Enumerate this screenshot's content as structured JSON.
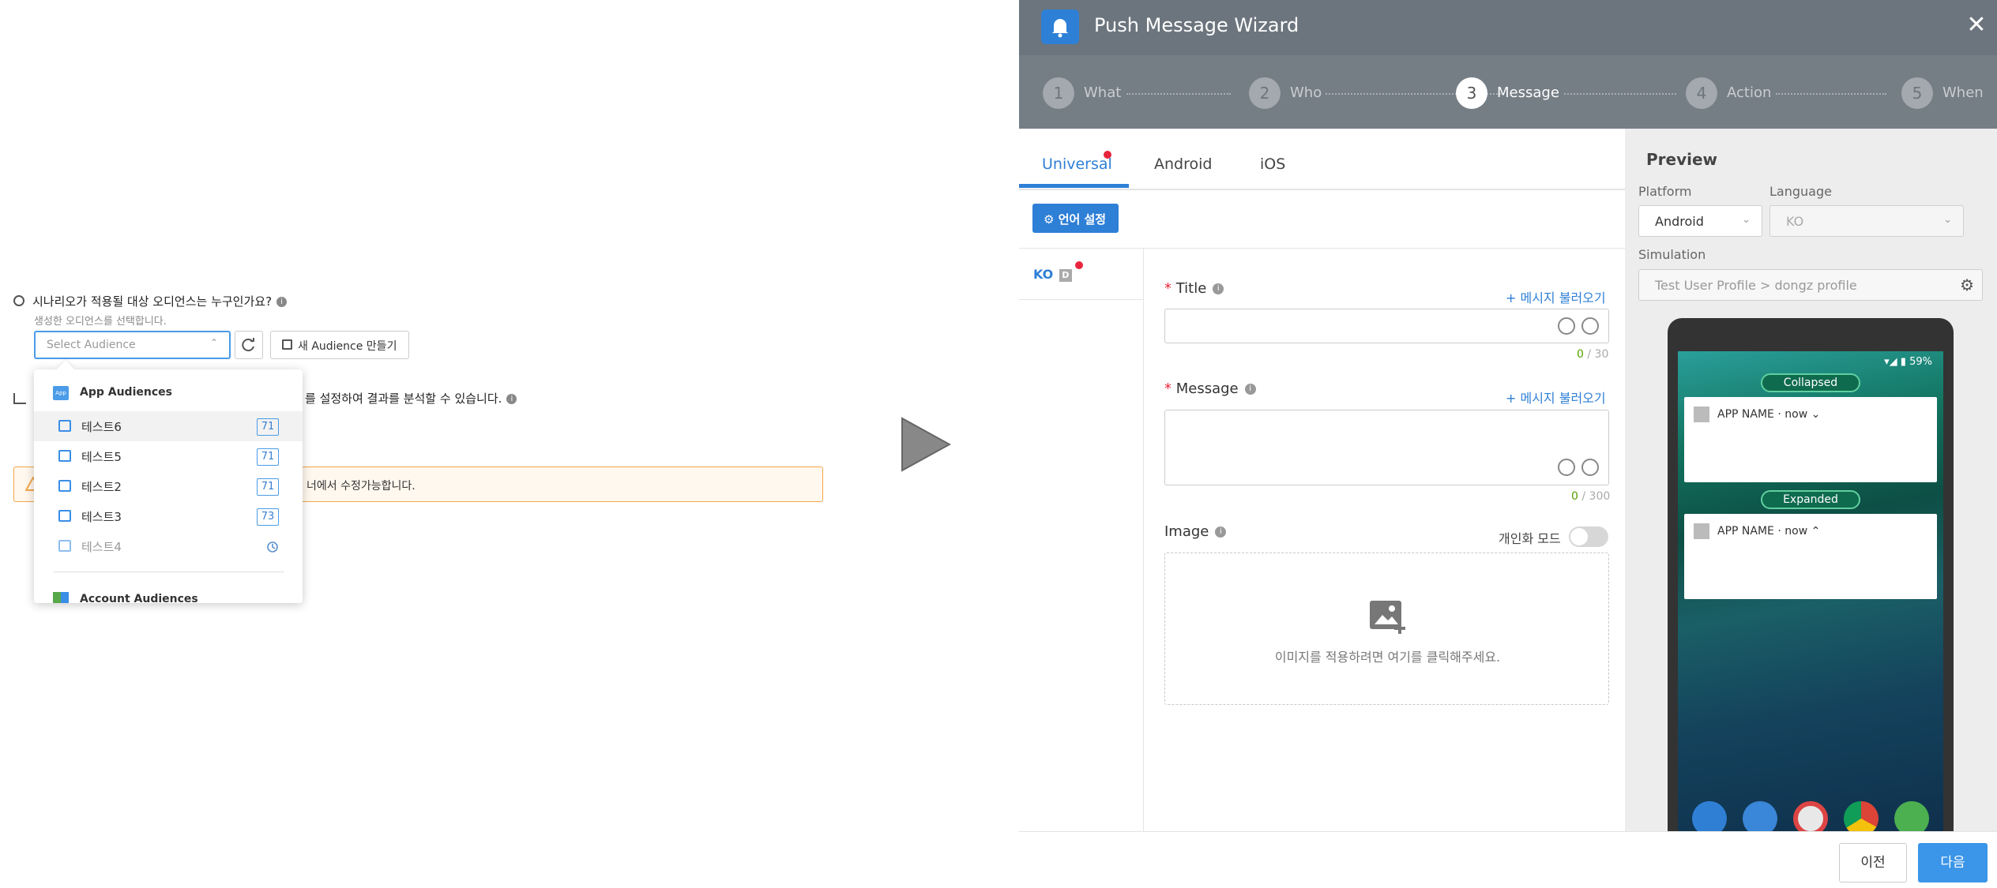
{
  "left": {
    "question1": "시나리오가 적용될 대상 오디언스는 누구인가요?",
    "question1_sub": "생성한 오디언스를 선택합니다.",
    "audience_placeholder": "Select Audience",
    "new_audience_label": "새 Audience 만들기",
    "question2_partial": "를 설정하여 결과를 분석할 수 있습니다.",
    "warning_partial": "너에서 수정가능합니다.",
    "dropdown": {
      "app_header": "App Audiences",
      "app_badge": "App",
      "items": [
        {
          "label": "테스트6",
          "count": "71",
          "disabled": false
        },
        {
          "label": "테스트5",
          "count": "71",
          "disabled": false
        },
        {
          "label": "테스트2",
          "count": "71",
          "disabled": false
        },
        {
          "label": "테스트3",
          "count": "73",
          "disabled": false
        },
        {
          "label": "테스트4",
          "count": "",
          "disabled": true
        }
      ],
      "account_header": "Account Audiences"
    }
  },
  "wizard": {
    "title": "Push Message Wizard",
    "close": "✕",
    "steps": [
      {
        "num": "1",
        "label": "What",
        "active": false
      },
      {
        "num": "2",
        "label": "Who",
        "active": false
      },
      {
        "num": "3",
        "label": "Message",
        "active": true
      },
      {
        "num": "4",
        "label": "Action",
        "active": false
      },
      {
        "num": "5",
        "label": "When",
        "active": false
      }
    ],
    "tabs": [
      "Universal",
      "Android",
      "iOS"
    ],
    "active_tab": "Universal",
    "lang_button": "언어 설정",
    "lang_tab": "KO",
    "lang_tab_badge": "D",
    "title_field": {
      "label": "Title",
      "load": "+ 메시지 불러오기",
      "count": "0",
      "max": "/ 30"
    },
    "message_field": {
      "label": "Message",
      "load": "+ 메시지 불러오기",
      "count": "0",
      "max": "/ 300"
    },
    "image_field": {
      "label": "Image",
      "personal_mode": "개인화 모드",
      "hint": "이미지를 적용하려면 여기를 클릭해주세요."
    },
    "preview": {
      "title": "Preview",
      "platform_label": "Platform",
      "platform_value": "Android",
      "language_label": "Language",
      "language_value": "KO",
      "simulation_label": "Simulation",
      "simulation_value": "Test User Profile > dongz profile",
      "battery": "59%",
      "collapsed": "Collapsed",
      "expanded": "Expanded",
      "app_name": "APP NAME",
      "time": "now"
    },
    "prev_button": "이전",
    "next_button": "다음"
  },
  "colors": {
    "accent": "#2e7fd6",
    "header": "#6c757d",
    "warning_border": "#f4a64a",
    "required": "#e8253c"
  }
}
